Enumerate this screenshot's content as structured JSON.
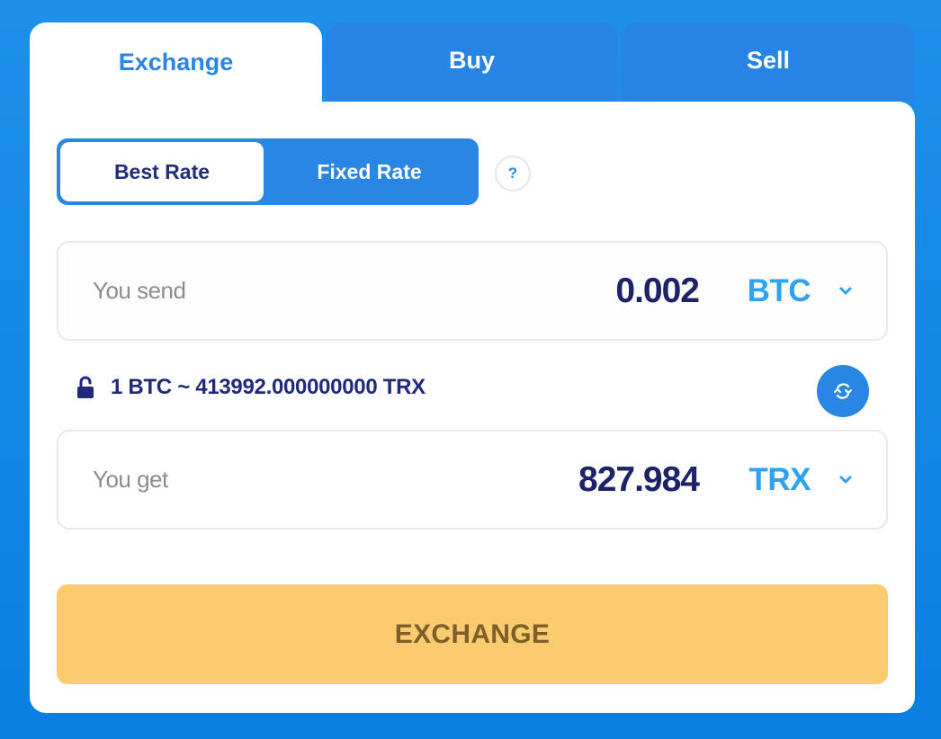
{
  "tabs": [
    {
      "label": "Exchange",
      "active": true
    },
    {
      "label": "Buy",
      "active": false
    },
    {
      "label": "Sell",
      "active": false
    }
  ],
  "rate_toggle": {
    "options": [
      {
        "label": "Best Rate",
        "selected": true
      },
      {
        "label": "Fixed Rate",
        "selected": false
      }
    ],
    "help_icon": "question-mark-icon",
    "help_label": "?"
  },
  "send": {
    "label": "You send",
    "amount": "0.002",
    "currency": "BTC",
    "dropdown_icon": "chevron-down-icon"
  },
  "rate": {
    "lock_icon": "unlock-icon",
    "text": "1 BTC ~ 413992.000000000 TRX",
    "swap_icon": "swap-arrows-icon"
  },
  "get": {
    "label": "You get",
    "amount": "827.984",
    "currency": "TRX",
    "dropdown_icon": "chevron-down-icon"
  },
  "actions": {
    "exchange_label": "EXCHANGE"
  },
  "colors": {
    "background": "#1e90ea",
    "tab_inactive": "#2884e4",
    "accent": "#2a86e3",
    "currency": "#2fa3f3",
    "amount_text": "#1c2467",
    "button": "#fbcb6f",
    "button_text": "#7e5f2a"
  }
}
